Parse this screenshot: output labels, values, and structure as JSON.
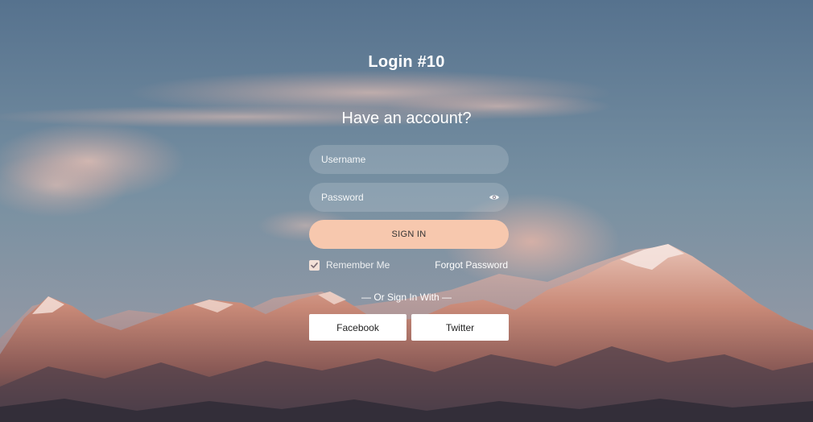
{
  "page": {
    "title": "Login #10",
    "subtitle": "Have an account?"
  },
  "form": {
    "username_placeholder": "Username",
    "password_placeholder": "Password",
    "signin_label": "SIGN IN",
    "remember_label": "Remember Me",
    "remember_checked": true,
    "forgot_label": "Forgot Password",
    "divider_text": "— Or Sign In With —"
  },
  "social": {
    "facebook_label": "Facebook",
    "twitter_label": "Twitter"
  },
  "icons": {
    "password_toggle": "eye-icon",
    "checkbox": "checkmark-icon"
  },
  "colors": {
    "signin_button": "#f7c8ae",
    "field_background": "rgba(255,255,255,0.16)",
    "social_button": "#ffffff"
  }
}
